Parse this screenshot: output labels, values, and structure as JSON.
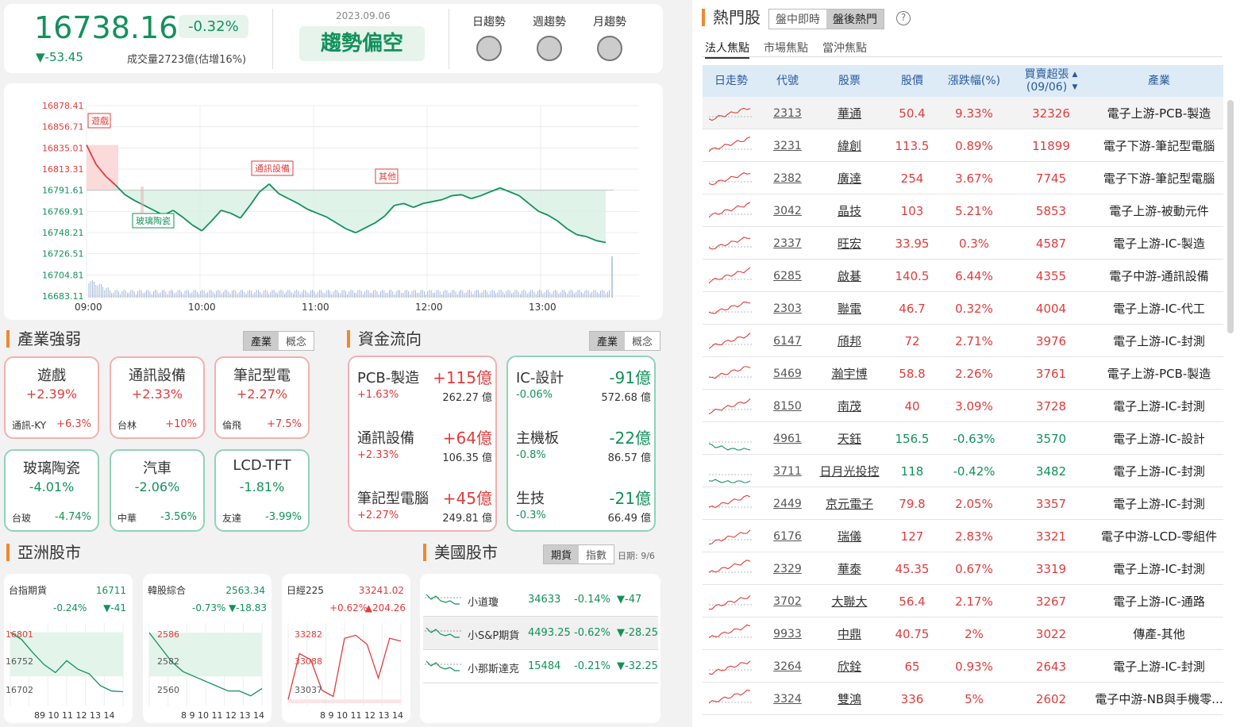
{
  "index": {
    "value": "16738.16",
    "change_pct": "-0.32%",
    "change": "▼-53.45",
    "volume": "成交量2723億(估增16%)",
    "date": "2023.09.06",
    "trend": "趨勢偏空"
  },
  "trends": [
    "日趨勢",
    "週趨勢",
    "月趨勢"
  ],
  "chart_data": {
    "type": "line",
    "y_ticks": [
      "16878.41",
      "16856.71",
      "16835.01",
      "16813.31",
      "16791.61",
      "16769.91",
      "16748.21",
      "16726.51",
      "16704.81",
      "16683.11"
    ],
    "x_ticks": [
      "09:00",
      "10:00",
      "11:00",
      "12:00",
      "13:00"
    ],
    "ylim": [
      16683.11,
      16878.41
    ],
    "reference": 16791.61,
    "annotations": [
      "遊戲",
      "玻璃陶瓷",
      "通訊設備",
      "其他"
    ],
    "x": [
      0,
      5,
      10,
      15,
      20,
      25,
      30,
      35,
      40,
      45,
      50,
      55,
      60,
      65,
      70,
      75,
      80,
      85,
      90,
      95,
      100,
      105,
      110,
      115,
      120,
      125,
      130,
      135,
      140,
      145,
      150,
      155,
      160,
      165,
      170,
      175,
      180,
      185,
      190,
      195,
      200,
      205,
      210,
      215,
      220,
      225,
      230,
      235,
      240,
      245,
      250,
      255,
      260,
      265,
      270
    ],
    "values": [
      16838,
      16818,
      16806,
      16797,
      16787,
      16781,
      16776,
      16771,
      16766,
      16771,
      16764,
      16756,
      16750,
      16760,
      16771,
      16768,
      16763,
      16776,
      16790,
      16798,
      16788,
      16783,
      16778,
      16772,
      16768,
      16764,
      16758,
      16752,
      16748,
      16753,
      16758,
      16765,
      16776,
      16778,
      16774,
      16778,
      16780,
      16782,
      16786,
      16787,
      16783,
      16786,
      16790,
      16794,
      16790,
      16786,
      16778,
      16770,
      16766,
      16760,
      16752,
      16746,
      16744,
      16740,
      16738
    ]
  },
  "sections": {
    "industry": "產業強弱",
    "flow": "資金流向",
    "asia": "亞洲股市",
    "us": "美國股市",
    "hot": "熱門股"
  },
  "segs": {
    "a": "產業",
    "b": "概念",
    "c": "期貨",
    "d": "指數",
    "date": "日期: 9/6"
  },
  "industry": [
    {
      "name": "遊戲",
      "pct": "+2.39%",
      "sub": "通訊-KY",
      "sv": "+6.3%",
      "dir": "up"
    },
    {
      "name": "通訊設備",
      "pct": "+2.33%",
      "sub": "台林",
      "sv": "+10%",
      "dir": "up"
    },
    {
      "name": "筆記型電",
      "pct": "+2.27%",
      "sub": "倫飛",
      "sv": "+7.5%",
      "dir": "up"
    },
    {
      "name": "玻璃陶瓷",
      "pct": "-4.01%",
      "sub": "台玻",
      "sv": "-4.74%",
      "dir": "dn"
    },
    {
      "name": "汽車",
      "pct": "-2.06%",
      "sub": "中華",
      "sv": "-3.56%",
      "dir": "dn"
    },
    {
      "name": "LCD-TFT",
      "pct": "-1.81%",
      "sub": "友達",
      "sv": "-3.99%",
      "dir": "dn"
    }
  ],
  "flow_in": [
    {
      "name": "PCB-製造",
      "amt": "+115億",
      "pct": "+1.63%",
      "vol": "262.27 億"
    },
    {
      "name": "通訊設備",
      "amt": "+64億",
      "pct": "+2.33%",
      "vol": "106.35 億"
    },
    {
      "name": "筆記型電腦",
      "amt": "+45億",
      "pct": "+2.27%",
      "vol": "249.81 億"
    }
  ],
  "flow_out": [
    {
      "name": "IC-設計",
      "amt": "-91億",
      "pct": "-0.06%",
      "vol": "572.68 億"
    },
    {
      "name": "主機板",
      "amt": "-22億",
      "pct": "-0.8%",
      "vol": "86.57 億"
    },
    {
      "name": "生技",
      "amt": "-21億",
      "pct": "-0.3%",
      "vol": "66.49 億"
    }
  ],
  "asia": [
    {
      "name": "台指期貨",
      "val": "16711",
      "pct": "-0.24%",
      "chg": "▼-41",
      "y1": "16801",
      "y2": "16752",
      "y3": "16702",
      "xt": "89 10 11 12 13 14"
    },
    {
      "name": "韓股綜合",
      "val": "2563.34",
      "pct": "-0.73%",
      "chg": "▼-18.83",
      "y1": "2586",
      "y2": "2582",
      "y3": "2560",
      "xt": "8 9 10 11 12 13 14"
    },
    {
      "name": "日經225",
      "val": "33241.02",
      "pct": "+0.62%",
      "chg": "▲204.26",
      "y1": "33282",
      "y2": "33088",
      "y3": "33037",
      "xt": "8 9 10 11 12 13 14"
    }
  ],
  "us": [
    {
      "name": "小道瓊",
      "val": "34633",
      "pct": "-0.14%",
      "chg": "▼-47"
    },
    {
      "name": "小S&P期貨",
      "val": "4493.25",
      "pct": "-0.62%",
      "chg": "▼-28.25"
    },
    {
      "name": "小那斯達克",
      "val": "15484",
      "pct": "-0.21%",
      "chg": "▼-32.25"
    }
  ],
  "hot_tabs": {
    "t1": "盤中即時",
    "t2": "盤後熱門",
    "s1": "法人焦點",
    "s2": "市場焦點",
    "s3": "當沖焦點"
  },
  "table_head": {
    "c1": "日走勢",
    "c2": "代號",
    "c3": "股票",
    "c4": "股價",
    "c5": "漲跌幅(%)",
    "c6": "買賣超張\n(09/06)",
    "c7": "產業"
  },
  "rows": [
    [
      "2313",
      "華通",
      "50.4",
      "9.33%",
      "32326",
      "電子上游-PCB-製造",
      "up"
    ],
    [
      "3231",
      "緯創",
      "113.5",
      "0.89%",
      "11899",
      "電子下游-筆記型電腦",
      "up"
    ],
    [
      "2382",
      "廣達",
      "254",
      "3.67%",
      "7745",
      "電子下游-筆記型電腦",
      "up"
    ],
    [
      "3042",
      "晶技",
      "103",
      "5.21%",
      "5853",
      "電子上游-被動元件",
      "up"
    ],
    [
      "2337",
      "旺宏",
      "33.95",
      "0.3%",
      "4587",
      "電子上游-IC-製造",
      "up"
    ],
    [
      "6285",
      "啟碁",
      "140.5",
      "6.44%",
      "4355",
      "電子中游-通訊設備",
      "up"
    ],
    [
      "2303",
      "聯電",
      "46.7",
      "0.32%",
      "4004",
      "電子上游-IC-代工",
      "up"
    ],
    [
      "6147",
      "頎邦",
      "72",
      "2.71%",
      "3976",
      "電子上游-IC-封測",
      "up"
    ],
    [
      "5469",
      "瀚宇博",
      "58.8",
      "2.26%",
      "3761",
      "電子上游-PCB-製造",
      "up"
    ],
    [
      "8150",
      "南茂",
      "40",
      "3.09%",
      "3728",
      "電子上游-IC-封測",
      "up"
    ],
    [
      "4961",
      "天鈺",
      "156.5",
      "-0.63%",
      "3570",
      "電子上游-IC-設計",
      "dn"
    ],
    [
      "3711",
      "日月光投控",
      "118",
      "-0.42%",
      "3482",
      "電子上游-IC-封測",
      "dn"
    ],
    [
      "2449",
      "京元電子",
      "79.8",
      "2.05%",
      "3357",
      "電子上游-IC-封測",
      "up"
    ],
    [
      "6176",
      "瑞儀",
      "127",
      "2.83%",
      "3321",
      "電子中游-LCD-零組件",
      "up"
    ],
    [
      "2329",
      "華泰",
      "45.35",
      "0.67%",
      "3319",
      "電子上游-IC-封測",
      "up"
    ],
    [
      "3702",
      "大聯大",
      "56.4",
      "2.17%",
      "3267",
      "電子上游-IC-通路",
      "up"
    ],
    [
      "9933",
      "中鼎",
      "40.75",
      "2%",
      "3022",
      "傳產-其他",
      "up"
    ],
    [
      "3264",
      "欣銓",
      "65",
      "0.93%",
      "2643",
      "電子上游-IC-封測",
      "up"
    ],
    [
      "3324",
      "雙鴻",
      "336",
      "5%",
      "2602",
      "電子中游-NB與手機零...",
      "up"
    ]
  ]
}
